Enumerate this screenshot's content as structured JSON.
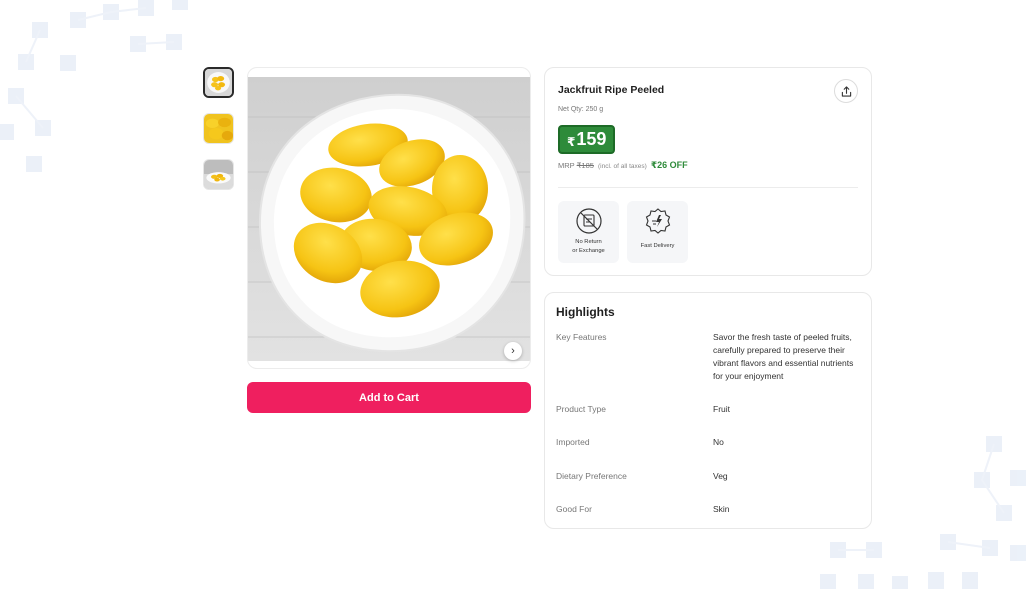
{
  "gallery": {
    "thumbnails": [
      {
        "name": "jackfruit-plate-thumb",
        "selected": true
      },
      {
        "name": "jackfruit-closeup-thumb",
        "selected": false
      },
      {
        "name": "jackfruit-bowl-thumb",
        "selected": false
      }
    ],
    "next_icon": "chevron-right-icon"
  },
  "cart": {
    "add_label": "Add to Cart",
    "color": "#ef1f5f"
  },
  "product": {
    "title": "Jackfruit Ripe Peeled",
    "net_qty": "Net Qty: 250 g",
    "currency": "₹",
    "price": "159",
    "mrp_label": "MRP",
    "mrp_value": "₹185",
    "taxes_note": "(incl. of all taxes)",
    "discount": "₹26 OFF",
    "price_color": "#2e8b3a",
    "share_icon": "share-icon"
  },
  "features": [
    {
      "icon": "no-return-icon",
      "line1": "No Return",
      "line2": "or Exchange"
    },
    {
      "icon": "fast-delivery-icon",
      "line1": "Fast Delivery",
      "line2": ""
    }
  ],
  "highlights": {
    "title": "Highlights",
    "rows": [
      {
        "key": "Key Features",
        "value": "Savor the fresh taste of peeled fruits, carefully prepared to preserve their vibrant flavors and essential nutrients for your enjoyment"
      },
      {
        "key": "Product Type",
        "value": "Fruit"
      },
      {
        "key": "Imported",
        "value": "No"
      },
      {
        "key": "Dietary Preference",
        "value": "Veg"
      },
      {
        "key": "Good For",
        "value": "Skin"
      }
    ]
  }
}
